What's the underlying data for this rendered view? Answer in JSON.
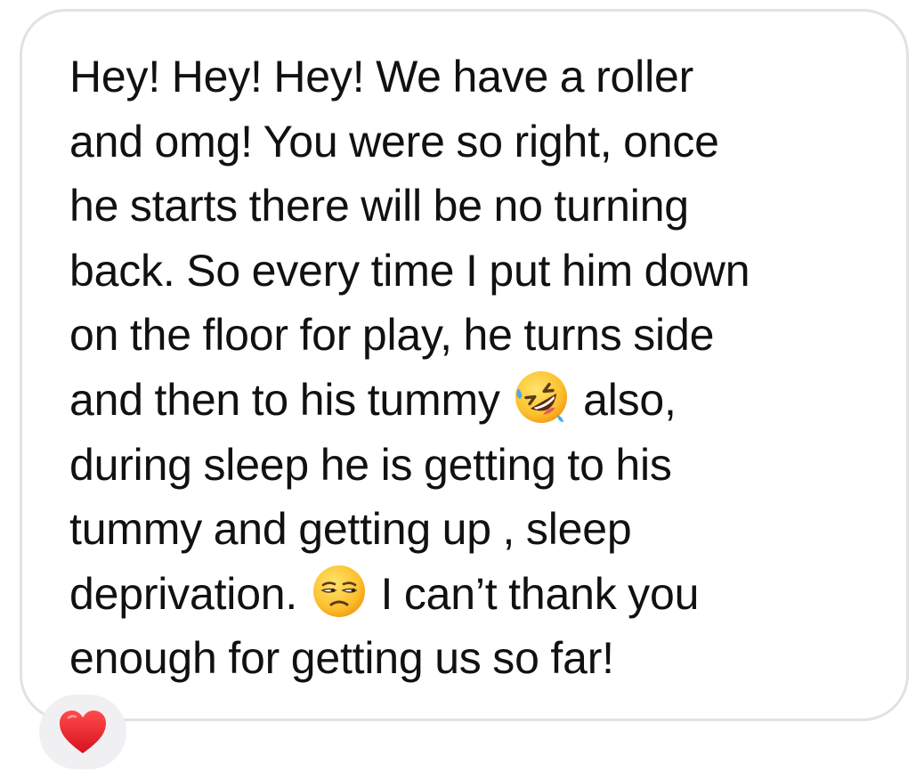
{
  "message": {
    "lines": [
      "Hey! Hey! Hey! We have a roller",
      "and omg! You were so right, once",
      "he starts there will be no turning",
      "back. So every time I put him down",
      "on the floor for play, he turns side",
      {
        "before": "and then to his tummy ",
        "after": " also,"
      },
      "during sleep he is getting to his",
      "tummy and getting up , sleep",
      {
        "before": "deprivation. ",
        "after": " I can’t thank you"
      },
      "enough for getting us so far!"
    ],
    "emojis": [
      "rolling-on-floor-laughing-emoji",
      "unamused-face-emoji"
    ]
  },
  "reaction": {
    "icon": "red-heart-icon",
    "color": "#e8202d"
  },
  "colors": {
    "bubble_border": "#e1e1e6",
    "reaction_bg": "#f0f0f2",
    "text": "#111111"
  }
}
